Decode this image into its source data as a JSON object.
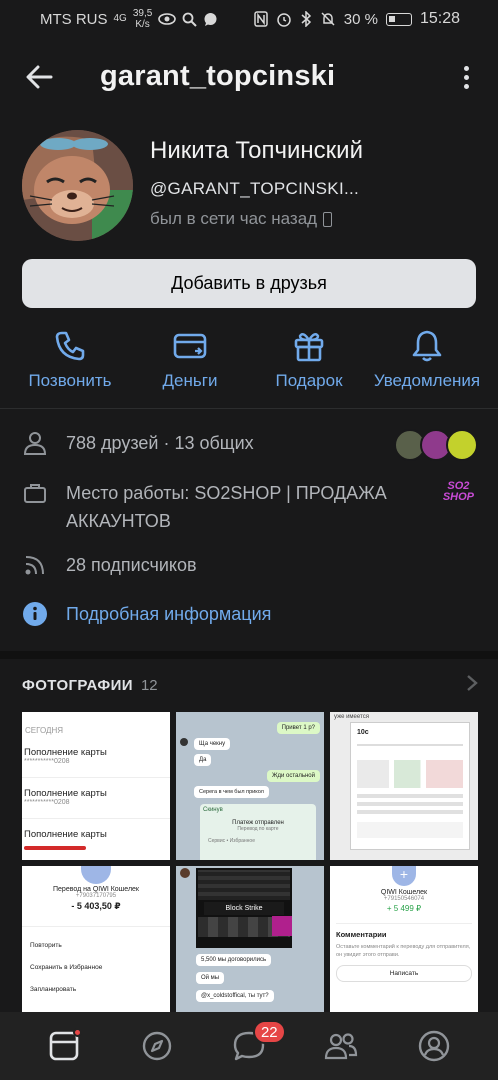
{
  "status_bar": {
    "carrier": "MTS RUS",
    "network": "4G",
    "speed_value": "39,5",
    "speed_unit": "K/s",
    "battery": "30 %",
    "time": "15:28"
  },
  "header": {
    "title": "garant_topcinski"
  },
  "profile": {
    "name": "Никита Топчинский",
    "username": "@GARANT_TOPCINSKI...",
    "last_seen": "был в сети час назад"
  },
  "add_friend_label": "Добавить в друзья",
  "actions": [
    {
      "label": "Позвонить",
      "icon": "phone-icon"
    },
    {
      "label": "Деньги",
      "icon": "money-icon"
    },
    {
      "label": "Подарок",
      "icon": "gift-icon"
    },
    {
      "label": "Уведомления",
      "icon": "bell-icon"
    }
  ],
  "info": {
    "friends": "788 друзей · 13 общих",
    "work": "Место работы: SO2SHOP | ПРОДАЖА АККАУНТОВ",
    "work_logo_line1": "SO2",
    "work_logo_line2": "SHOP",
    "subscribers": "28 подписчиков",
    "details_link": "Подробная информация"
  },
  "photos": {
    "title": "ФОТОГРАФИИ",
    "count": "12",
    "p1": {
      "header": "СЕГОДНЯ",
      "rows": [
        {
          "title": "Пополнение карты",
          "sub": "***********0208"
        },
        {
          "title": "Пополнение карты",
          "sub": "***********0208"
        },
        {
          "title": "Пополнение карты",
          "sub": ""
        }
      ]
    },
    "p2": {
      "m1": "Привет 1 р?",
      "m2": "Ща чекну",
      "m3": "Да",
      "m4": "Жди остальной",
      "m5": "Серега в чем был прикол",
      "m6": "Скинув",
      "m7": "Платеж отправлен",
      "m8": "Перевод по карте",
      "m9": "Сервис • Избранное"
    },
    "p3": {
      "line": "уже имеется",
      "price": "10с"
    },
    "p4": {
      "title": "Перевод на QIWI Кошелек",
      "phone": "+79037170795",
      "amount": "- 5 403,50 ₽",
      "menu": [
        "Повторить",
        "Сохранить в Избранное",
        "Запланировать"
      ]
    },
    "p5": {
      "game": "Block Strike",
      "m1": "5,500 мы договорились",
      "m2": "Ой мы",
      "m3": "@x_coldstoffical, ты тут?"
    },
    "p6": {
      "title": "QIWI Кошелек",
      "phone": "+79150546074",
      "amount": "+ 5 499 ₽",
      "comments_title": "Комментарии",
      "comments_text": "Оставьте комментарий к переводу для отправителя, он увидит этого отправи.",
      "write_button": "Написать"
    }
  },
  "bottom_nav": {
    "messages_badge": "22",
    "items": [
      "home-icon",
      "compass-icon",
      "messages-icon",
      "friends-icon",
      "profile-icon"
    ]
  },
  "colors": {
    "accent": "#71aaeb",
    "background": "#19191a",
    "badge": "#e64646",
    "button": "#e1e3e6"
  }
}
